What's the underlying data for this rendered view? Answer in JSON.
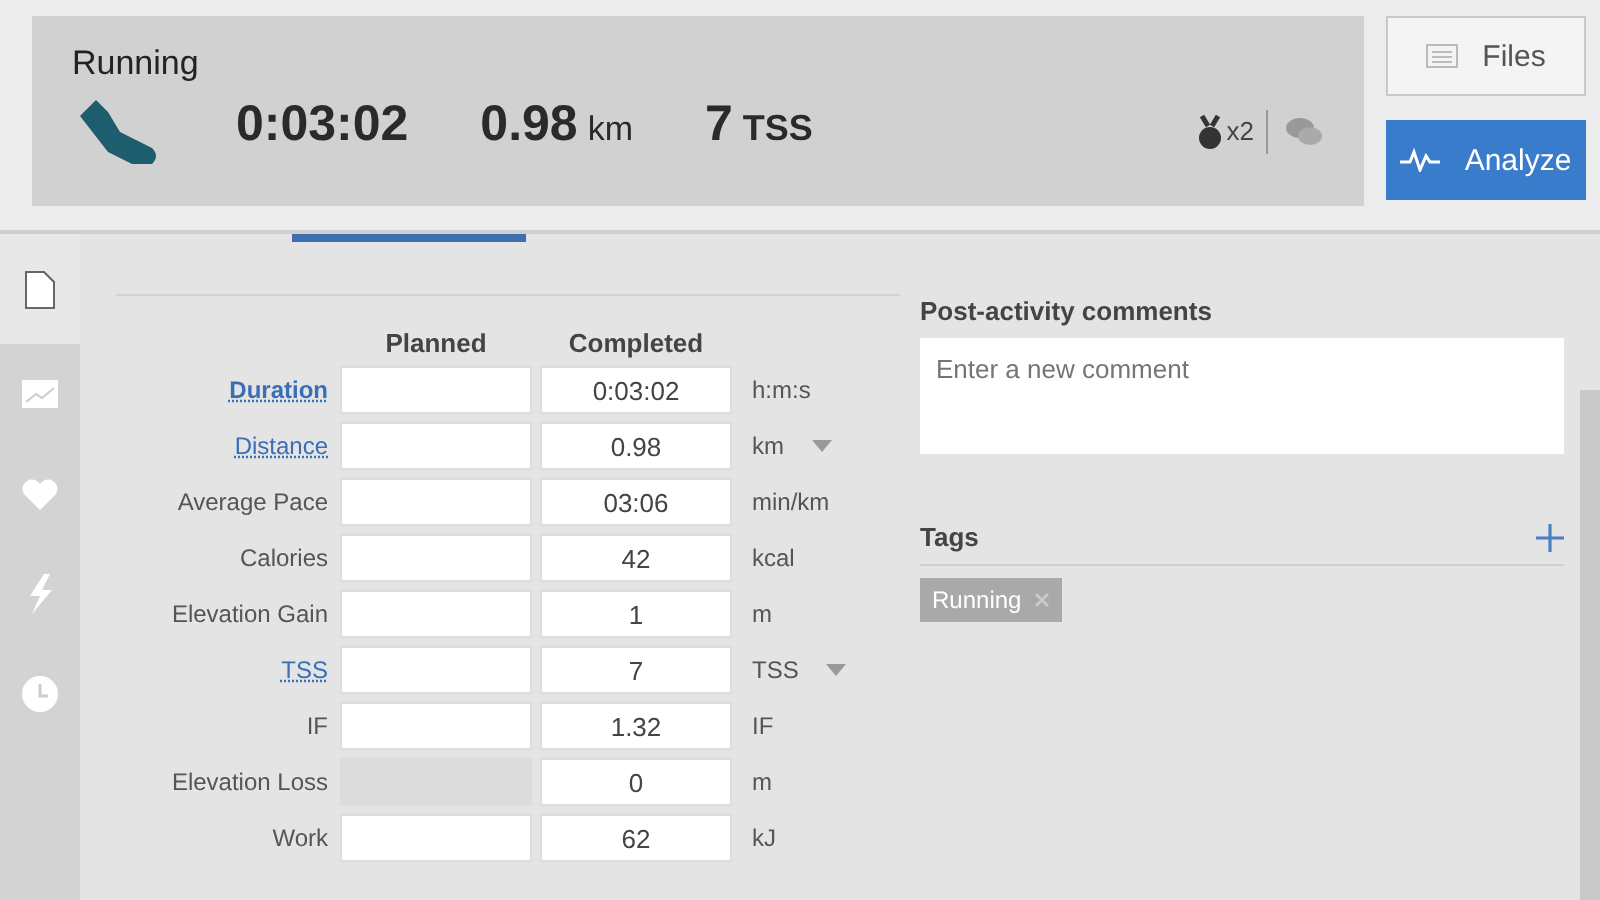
{
  "summary": {
    "sport": "Running",
    "duration": "0:03:02",
    "distance": "0.98",
    "distance_unit": "km",
    "tss": "7",
    "tss_unit": "TSS",
    "medals": "x2"
  },
  "buttons": [
    {
      "kind": "files",
      "label": "Files"
    },
    {
      "kind": "analyze",
      "label": "Analyze"
    }
  ],
  "sidebar": {
    "items": [
      {
        "kind": "document",
        "selected": true
      },
      {
        "kind": "chart",
        "selected": false
      },
      {
        "kind": "heart",
        "selected": false
      },
      {
        "kind": "bolt",
        "selected": false
      },
      {
        "kind": "clock",
        "selected": false
      }
    ]
  },
  "table": {
    "columns": [
      "Planned",
      "Completed"
    ],
    "rows": [
      {
        "label": "Duration",
        "kind": "strong-link",
        "planned_disabled": false,
        "completed": "0:03:02",
        "unit": "h:m:s",
        "dropdown": false
      },
      {
        "label": "Distance",
        "kind": "link",
        "planned_disabled": false,
        "completed": "0.98",
        "unit": "km",
        "dropdown": true
      },
      {
        "label": "Average Pace",
        "kind": "plain",
        "planned_disabled": false,
        "completed": "03:06",
        "unit": "min/km",
        "dropdown": false
      },
      {
        "label": "Calories",
        "kind": "plain",
        "planned_disabled": false,
        "completed": "42",
        "unit": "kcal",
        "dropdown": false
      },
      {
        "label": "Elevation Gain",
        "kind": "plain",
        "planned_disabled": false,
        "completed": "1",
        "unit": "m",
        "dropdown": false
      },
      {
        "label": "TSS",
        "kind": "link",
        "planned_disabled": false,
        "completed": "7",
        "unit": "TSS",
        "dropdown": true
      },
      {
        "label": "IF",
        "kind": "plain",
        "planned_disabled": false,
        "completed": "1.32",
        "unit": "IF",
        "dropdown": false
      },
      {
        "label": "Elevation Loss",
        "kind": "plain",
        "planned_disabled": true,
        "completed": "0",
        "unit": "m",
        "dropdown": false
      },
      {
        "label": "Work",
        "kind": "plain",
        "planned_disabled": false,
        "completed": "62",
        "unit": "kJ",
        "dropdown": false
      }
    ]
  },
  "comments": {
    "title": "Post-activity comments",
    "placeholder": "Enter a new comment"
  },
  "tags": {
    "title": "Tags",
    "items": [
      "Running"
    ]
  }
}
